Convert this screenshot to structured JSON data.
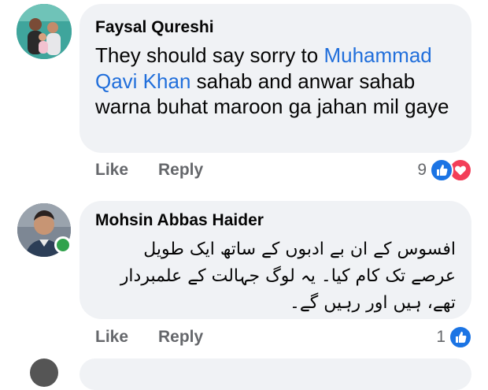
{
  "comments": [
    {
      "author": "Faysal Qureshi",
      "text_before": "They should say sorry to ",
      "mention": "Muhammad Qavi Khan",
      "text_after": " sahab and anwar sahab warna buhat maroon ga jahan mil gaye",
      "like_label": "Like",
      "reply_label": "Reply",
      "reaction_count": "9",
      "reactions": [
        "like-icon",
        "love-icon"
      ]
    },
    {
      "author": "Mohsin Abbas Haider",
      "text": "افسوس کے ان بے ادبوں کے ساتھ ایک طویل عرصے تک کام کیا۔ یہ لوگ جہالت کے علمبردار تھے، ہیں اور رہیں گے۔",
      "like_label": "Like",
      "reply_label": "Reply",
      "reaction_count": "1",
      "reactions": [
        "like-icon"
      ],
      "online": true
    }
  ],
  "colors": {
    "bubble": "#f0f2f5",
    "mention": "#216fdb",
    "action_text": "#65676b",
    "like": "#1b74e4",
    "love": "#f33e58",
    "online": "#31a24c"
  }
}
